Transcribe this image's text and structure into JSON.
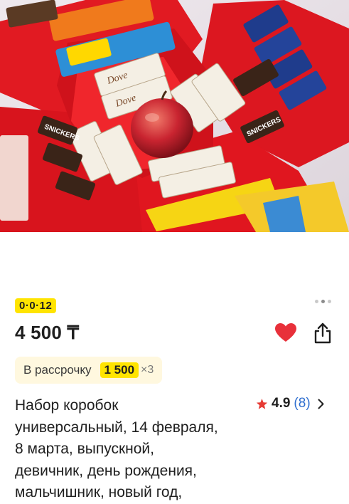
{
  "photo": {
    "alt": "Набор коробок с конфетами",
    "brands": {
      "snickers": "SNICKERS",
      "dove": "Dove"
    }
  },
  "promo_badge": "0·0·12",
  "gallery": {
    "total": 3,
    "active": 1
  },
  "price": "4 500 ₸",
  "actions": {
    "favorite_icon": "heart-icon",
    "share_icon": "share-icon"
  },
  "installment": {
    "label": "В рассрочку",
    "amount": "1 500",
    "multiplier": "×3"
  },
  "product": {
    "title_lines": [
      "Набор коробок",
      "универсальный, 14 февраля,",
      "8 марта, выпускной,",
      "девичник, день рождения,",
      "мальчишник, новый год,"
    ]
  },
  "rating": {
    "value": "4.9",
    "count": "(8)"
  },
  "colors": {
    "accent_yellow": "#ffe400",
    "heart_red": "#e8303a",
    "star_red": "#e63b35",
    "link_blue": "#2f6fd0"
  }
}
